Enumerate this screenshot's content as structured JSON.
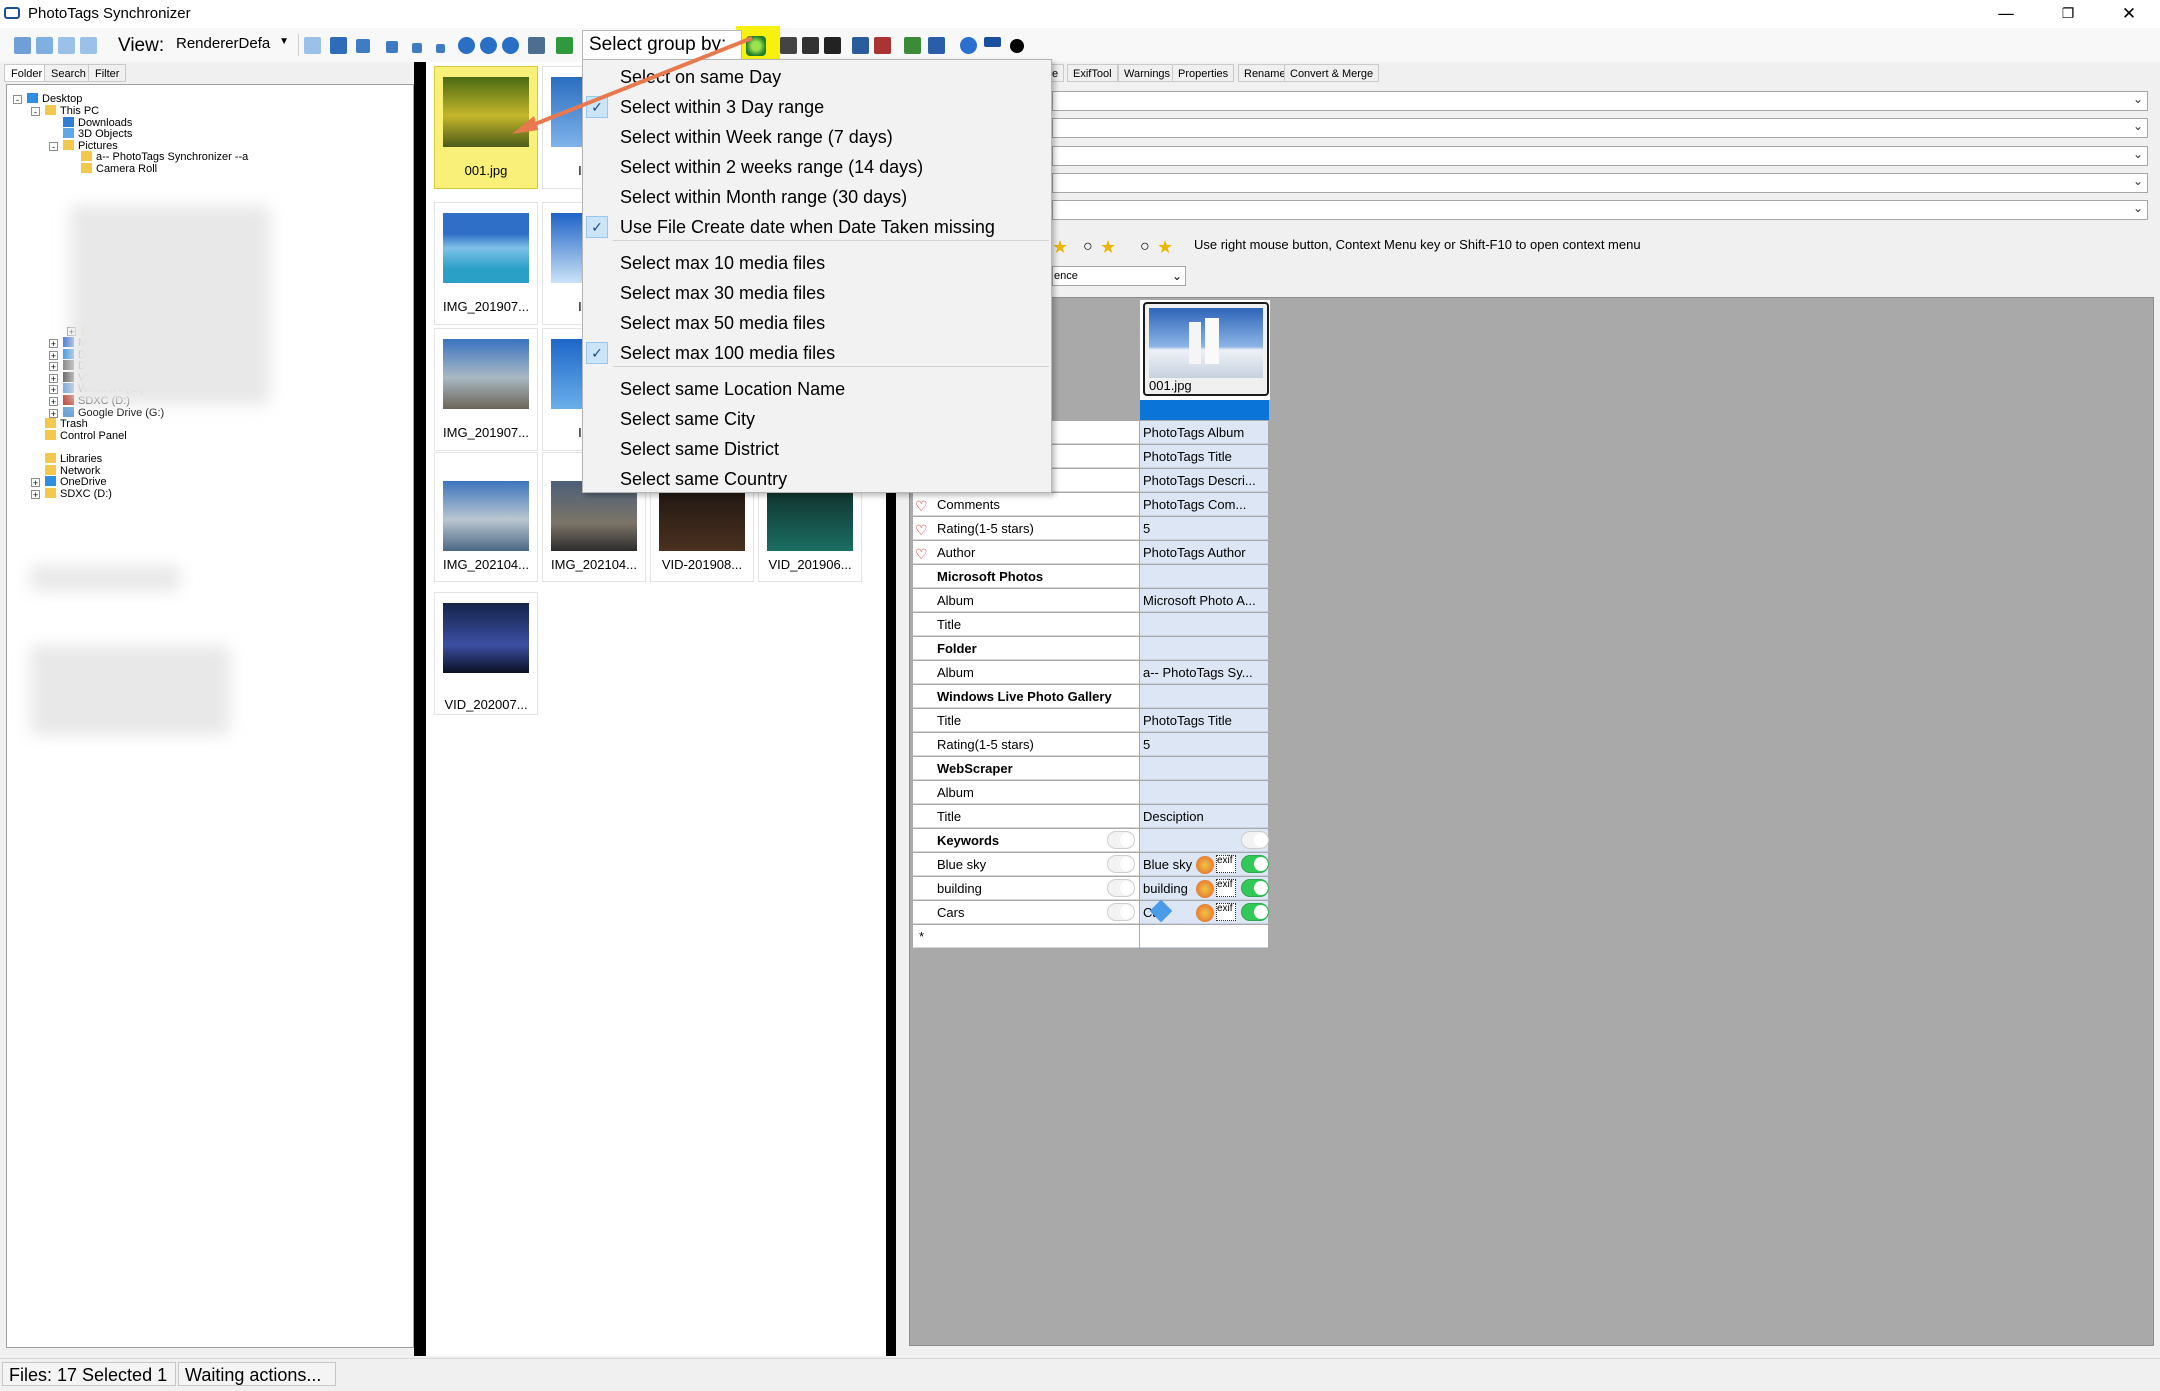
{
  "window": {
    "title": "PhotoTags Synchronizer"
  },
  "toolbar": {
    "view_label": "View:",
    "view_value": "RendererDefa",
    "group_by_label": "Select group by:"
  },
  "left_tabs": [
    "Folder",
    "Search",
    "Filter"
  ],
  "tree": [
    {
      "label": "Desktop",
      "icon": "desktop-icon",
      "level": 0,
      "expander": "-"
    },
    {
      "label": "This PC",
      "icon": "folder-icon",
      "level": 1,
      "expander": "-"
    },
    {
      "label": "Downloads",
      "icon": "download-icon",
      "level": 2,
      "expander": ""
    },
    {
      "label": "3D Objects",
      "icon": "cube-icon",
      "level": 2,
      "expander": ""
    },
    {
      "label": "Pictures",
      "icon": "folder-icon",
      "level": 2,
      "expander": "-"
    },
    {
      "label": "a-- PhotoTags Synchronizer --a",
      "icon": "folder-icon",
      "level": 3,
      "expander": ""
    },
    {
      "label": "Camera Roll",
      "icon": "folder-icon",
      "level": 3,
      "expander": ""
    },
    {
      "label": "Users",
      "icon": "folder-icon",
      "level": 3,
      "expander": "+"
    },
    {
      "label": "Music",
      "icon": "music-icon",
      "level": 2,
      "expander": "+"
    },
    {
      "label": "Desktop",
      "icon": "desktop-icon",
      "level": 2,
      "expander": "+"
    },
    {
      "label": "Documents",
      "icon": "document-icon",
      "level": 2,
      "expander": "+"
    },
    {
      "label": "Videos",
      "icon": "video-icon",
      "level": 2,
      "expander": "+"
    },
    {
      "label": "Windows (C:)",
      "icon": "drive-icon",
      "level": 2,
      "expander": "+"
    },
    {
      "label": "SDXC (D:)",
      "icon": "sd-card-icon",
      "level": 2,
      "expander": "+"
    },
    {
      "label": "Google Drive (G:)",
      "icon": "drive-icon",
      "level": 2,
      "expander": "+"
    },
    {
      "label": "Trash",
      "icon": "folder-icon",
      "level": 1,
      "expander": ""
    },
    {
      "label": "Control Panel",
      "icon": "folder-icon",
      "level": 1,
      "expander": ""
    },
    {
      "label": "Libraries",
      "icon": "folder-icon",
      "level": 1,
      "expander": ""
    },
    {
      "label": "Network",
      "icon": "folder-icon",
      "level": 1,
      "expander": ""
    },
    {
      "label": "OneDrive",
      "icon": "cloud-icon",
      "level": 1,
      "expander": "+"
    },
    {
      "label": "SDXC (D:)",
      "icon": "folder-icon",
      "level": 1,
      "expander": "+"
    }
  ],
  "thumbnails": [
    {
      "caption": "001.jpg",
      "selected": true
    },
    {
      "caption": "IMG_",
      "selected": false
    },
    {
      "caption": "IMG_201907...",
      "selected": false
    },
    {
      "caption": "IMG_",
      "selected": false
    },
    {
      "caption": "IMG_201907...",
      "selected": false
    },
    {
      "caption": "IMG_",
      "selected": false
    },
    {
      "caption": "IMG_202104...",
      "selected": false
    },
    {
      "caption": "IMG_202104...",
      "selected": false
    },
    {
      "caption": "VID-201908...",
      "selected": false
    },
    {
      "caption": "VID_201906...",
      "selected": false
    },
    {
      "caption": "VID_202007...",
      "selected": false
    }
  ],
  "group_menu": {
    "items": [
      {
        "label": "Select on same Day",
        "checked": false
      },
      {
        "label": "Select within 3 Day range",
        "checked": true
      },
      {
        "label": "Select within Week range (7 days)",
        "checked": false
      },
      {
        "label": "Select within 2 weeks range (14 days)",
        "checked": false
      },
      {
        "label": "Select within Month range (30 days)",
        "checked": false
      },
      {
        "label": "Use File Create date when Date Taken missing",
        "checked": true
      },
      {
        "label": "Select max 10 media files",
        "checked": false
      },
      {
        "label": "Select max 30 media files",
        "checked": false
      },
      {
        "label": "Select max 50 media files",
        "checked": false
      },
      {
        "label": "Select max 100 media files",
        "checked": true
      },
      {
        "label": "Select same Location Name",
        "checked": false
      },
      {
        "label": "Select same City",
        "checked": false
      },
      {
        "label": "Select same District",
        "checked": false
      },
      {
        "label": "Select same Country",
        "checked": false
      }
    ]
  },
  "right_tabs": [
    "e",
    "ExifTool",
    "Warnings",
    "Properties",
    "Rename",
    "Convert & Merge"
  ],
  "rating_hint": "Use right mouse button, Context Menu key or Shift-F10 to open context menu",
  "partial_select_value": "ence",
  "grid": {
    "file_caption": "001.jpg",
    "rows": [
      {
        "key": "",
        "value": "PhotoTags Album",
        "heart": false,
        "bold": false
      },
      {
        "key": "",
        "value": "PhotoTags Title",
        "heart": false,
        "bold": false
      },
      {
        "key": "",
        "value": "PhotoTags Descri...",
        "heart": false,
        "bold": false
      },
      {
        "key": "Comments",
        "value": "PhotoTags Com...",
        "heart": true,
        "bold": false
      },
      {
        "key": "Rating(1-5 stars)",
        "value": "5",
        "heart": true,
        "bold": false
      },
      {
        "key": "Author",
        "value": "PhotoTags Author",
        "heart": true,
        "bold": false
      },
      {
        "key": "Microsoft Photos",
        "value": "",
        "heart": false,
        "bold": true
      },
      {
        "key": "Album",
        "value": "Microsoft Photo A...",
        "heart": false,
        "bold": false
      },
      {
        "key": "Title",
        "value": "",
        "heart": false,
        "bold": false
      },
      {
        "key": "Folder",
        "value": "",
        "heart": false,
        "bold": true
      },
      {
        "key": "Album",
        "value": "a-- PhotoTags Sy...",
        "heart": false,
        "bold": false
      },
      {
        "key": "Windows Live Photo Gallery",
        "value": "",
        "heart": false,
        "bold": true
      },
      {
        "key": "Title",
        "value": "PhotoTags Title",
        "heart": false,
        "bold": false
      },
      {
        "key": "Rating(1-5 stars)",
        "value": "5",
        "heart": false,
        "bold": false
      },
      {
        "key": "WebScraper",
        "value": "",
        "heart": false,
        "bold": true
      },
      {
        "key": "Album",
        "value": "",
        "heart": false,
        "bold": false
      },
      {
        "key": "Title",
        "value": "Desciption",
        "heart": false,
        "bold": false
      },
      {
        "key": "Keywords",
        "value": "",
        "heart": false,
        "bold": true,
        "toggle": "off"
      },
      {
        "key": "Blue sky",
        "value": "Blue sky",
        "heart": false,
        "bold": false,
        "toggle": "on"
      },
      {
        "key": "building",
        "value": "building",
        "heart": false,
        "bold": false,
        "toggle": "on"
      },
      {
        "key": "Cars",
        "value": "Ca",
        "heart": false,
        "bold": false,
        "toggle": "on"
      },
      {
        "key": "*",
        "value": "",
        "heart": false,
        "bold": false
      }
    ]
  },
  "status": {
    "files": "Files: 17 Selected 1",
    "state": "Waiting actions..."
  },
  "colors": {
    "selected_thumb": "#f8f078",
    "highlight": "#f8f00f",
    "grid_value_bg": "#dce6f4",
    "grid_bg": "#a9a9a9",
    "arrow": "#e8794f"
  }
}
